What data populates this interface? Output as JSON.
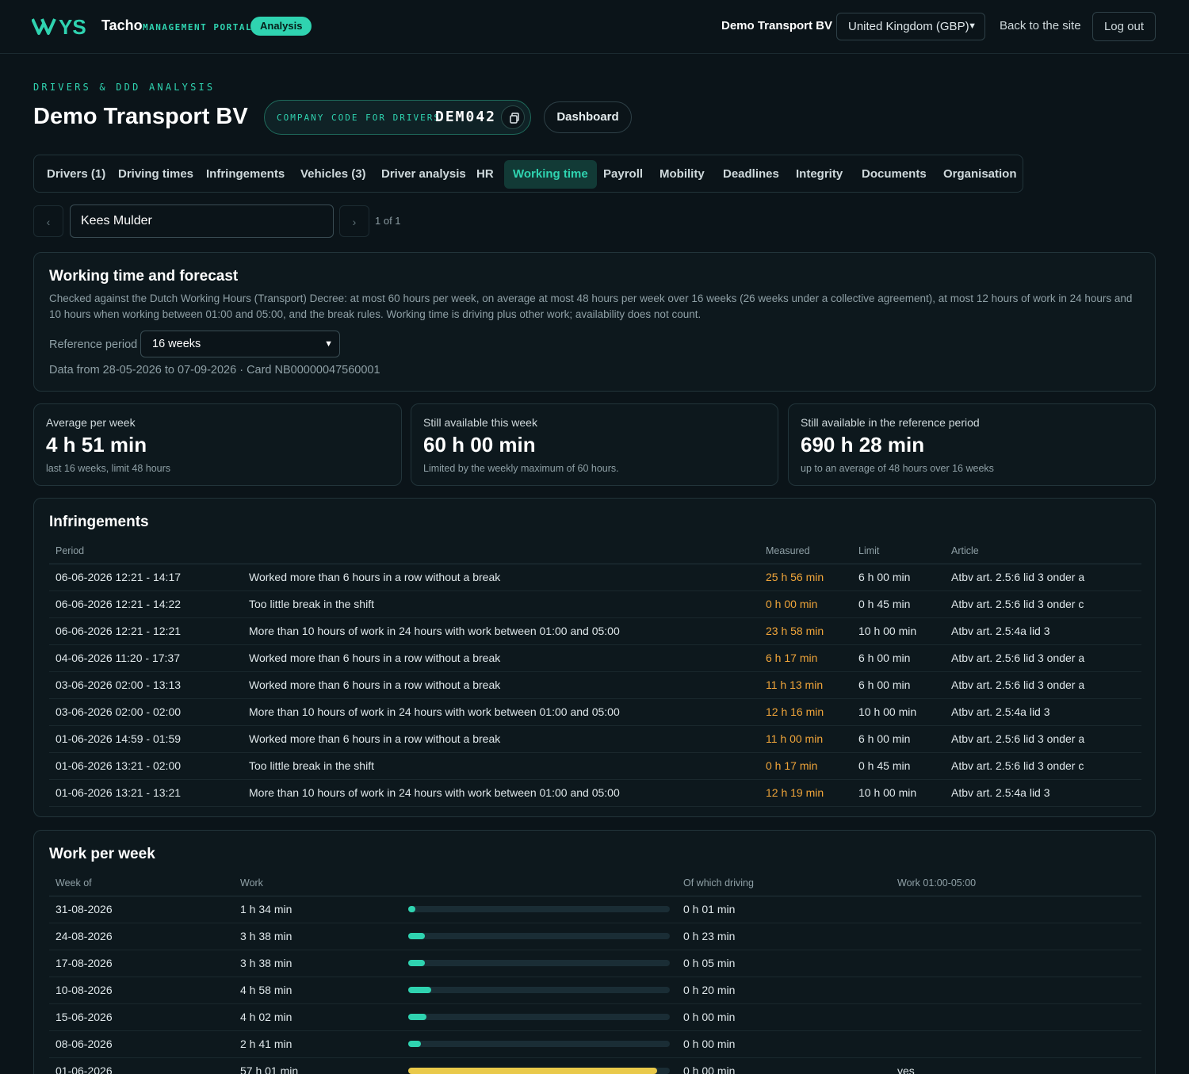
{
  "topbar": {
    "brand": "Tacho",
    "brand_sub": "MANAGEMENT PORTAL",
    "analysis_pill": "Analysis",
    "company": "Demo Transport BV",
    "country_select": "United Kingdom (GBP)",
    "back_link": "Back to the site",
    "logout": "Log out"
  },
  "header": {
    "eyebrow": "DRIVERS & DDD ANALYSIS",
    "title": "Demo Transport BV",
    "code_label": "COMPANY CODE FOR DRIVERS",
    "code_value": "DEM042",
    "dashboard_button": "Dashboard"
  },
  "tabs": [
    {
      "label": "Drivers (1)"
    },
    {
      "label": "Driving times"
    },
    {
      "label": "Infringements"
    },
    {
      "label": "Vehicles (3)"
    },
    {
      "label": "Driver analysis"
    },
    {
      "label": "HR"
    },
    {
      "label": "Working time",
      "active": true
    },
    {
      "label": "Payroll"
    },
    {
      "label": "Mobility"
    },
    {
      "label": "Deadlines"
    },
    {
      "label": "Integrity"
    },
    {
      "label": "Documents"
    },
    {
      "label": "Organisation"
    }
  ],
  "driver_selector": {
    "prev": "‹",
    "next": "›",
    "driver": "Kees Mulder",
    "pager": "1 of 1"
  },
  "forecast": {
    "title": "Working time and forecast",
    "description": "Checked against the Dutch Working Hours (Transport) Decree: at most 60 hours per week, on average at most 48 hours per week over 16 weeks (26 weeks under a collective agreement), at most 12 hours of work in 24 hours and 10 hours when working between 01:00 and 05:00, and the break rules. Working time is driving plus other work; availability does not count.",
    "ref_label": "Reference period",
    "ref_value": "16 weeks",
    "data_from": "Data from 28-05-2026 to 07-09-2026 · Card NB00000047560001"
  },
  "stats": [
    {
      "label": "Average per week",
      "value": "4 h 51 min",
      "sub": "last 16 weeks, limit 48 hours"
    },
    {
      "label": "Still available this week",
      "value": "60 h 00 min",
      "sub": "Limited by the weekly maximum of 60 hours."
    },
    {
      "label": "Still available in the reference period",
      "value": "690 h 28 min",
      "sub": "up to an average of 48 hours over 16 weeks"
    }
  ],
  "infringements": {
    "title": "Infringements",
    "headers": {
      "period": "Period",
      "description": "",
      "measured": "Measured",
      "limit": "Limit",
      "article": "Article"
    },
    "rows": [
      {
        "period": "06-06-2026 12:21 - 14:17",
        "description": "Worked more than 6 hours in a row without a break",
        "measured": "25 h 56 min",
        "limit": "6 h 00 min",
        "article": "Atbv art. 2.5:6 lid 3 onder a"
      },
      {
        "period": "06-06-2026 12:21 - 14:22",
        "description": "Too little break in the shift",
        "measured": "0 h 00 min",
        "limit": "0 h 45 min",
        "article": "Atbv art. 2.5:6 lid 3 onder c"
      },
      {
        "period": "06-06-2026 12:21 - 12:21",
        "description": "More than 10 hours of work in 24 hours with work between 01:00 and 05:00",
        "measured": "23 h 58 min",
        "limit": "10 h 00 min",
        "article": "Atbv art. 2.5:4a lid 3"
      },
      {
        "period": "04-06-2026 11:20 - 17:37",
        "description": "Worked more than 6 hours in a row without a break",
        "measured": "6 h 17 min",
        "limit": "6 h 00 min",
        "article": "Atbv art. 2.5:6 lid 3 onder a"
      },
      {
        "period": "03-06-2026 02:00 - 13:13",
        "description": "Worked more than 6 hours in a row without a break",
        "measured": "11 h 13 min",
        "limit": "6 h 00 min",
        "article": "Atbv art. 2.5:6 lid 3 onder a"
      },
      {
        "period": "03-06-2026 02:00 - 02:00",
        "description": "More than 10 hours of work in 24 hours with work between 01:00 and 05:00",
        "measured": "12 h 16 min",
        "limit": "10 h 00 min",
        "article": "Atbv art. 2.5:4a lid 3"
      },
      {
        "period": "01-06-2026 14:59 - 01:59",
        "description": "Worked more than 6 hours in a row without a break",
        "measured": "11 h 00 min",
        "limit": "6 h 00 min",
        "article": "Atbv art. 2.5:6 lid 3 onder a"
      },
      {
        "period": "01-06-2026 13:21 - 02:00",
        "description": "Too little break in the shift",
        "measured": "0 h 17 min",
        "limit": "0 h 45 min",
        "article": "Atbv art. 2.5:6 lid 3 onder c"
      },
      {
        "period": "01-06-2026 13:21 - 13:21",
        "description": "More than 10 hours of work in 24 hours with work between 01:00 and 05:00",
        "measured": "12 h 19 min",
        "limit": "10 h 00 min",
        "article": "Atbv art. 2.5:4a lid 3"
      }
    ]
  },
  "work_per_week": {
    "title": "Work per week",
    "headers": {
      "week": "Week of",
      "work": "Work",
      "driving": "Of which driving",
      "night": "Work 01:00-05:00"
    },
    "rows": [
      {
        "week": "31-08-2026",
        "work": "1 h 34 min",
        "fraction": 0.027,
        "over": false,
        "driving": "0 h 01 min",
        "night": ""
      },
      {
        "week": "24-08-2026",
        "work": "3 h 38 min",
        "fraction": 0.063,
        "over": false,
        "driving": "0 h 23 min",
        "night": ""
      },
      {
        "week": "17-08-2026",
        "work": "3 h 38 min",
        "fraction": 0.063,
        "over": false,
        "driving": "0 h 05 min",
        "night": ""
      },
      {
        "week": "10-08-2026",
        "work": "4 h 58 min",
        "fraction": 0.087,
        "over": false,
        "driving": "0 h 20 min",
        "night": ""
      },
      {
        "week": "15-06-2026",
        "work": "4 h 02 min",
        "fraction": 0.071,
        "over": false,
        "driving": "0 h 00 min",
        "night": ""
      },
      {
        "week": "08-06-2026",
        "work": "2 h 41 min",
        "fraction": 0.047,
        "over": false,
        "driving": "0 h 00 min",
        "night": ""
      },
      {
        "week": "01-06-2026",
        "work": "57 h 01 min",
        "fraction": 0.95,
        "over": true,
        "driving": "0 h 00 min",
        "night": "yes"
      }
    ]
  }
}
